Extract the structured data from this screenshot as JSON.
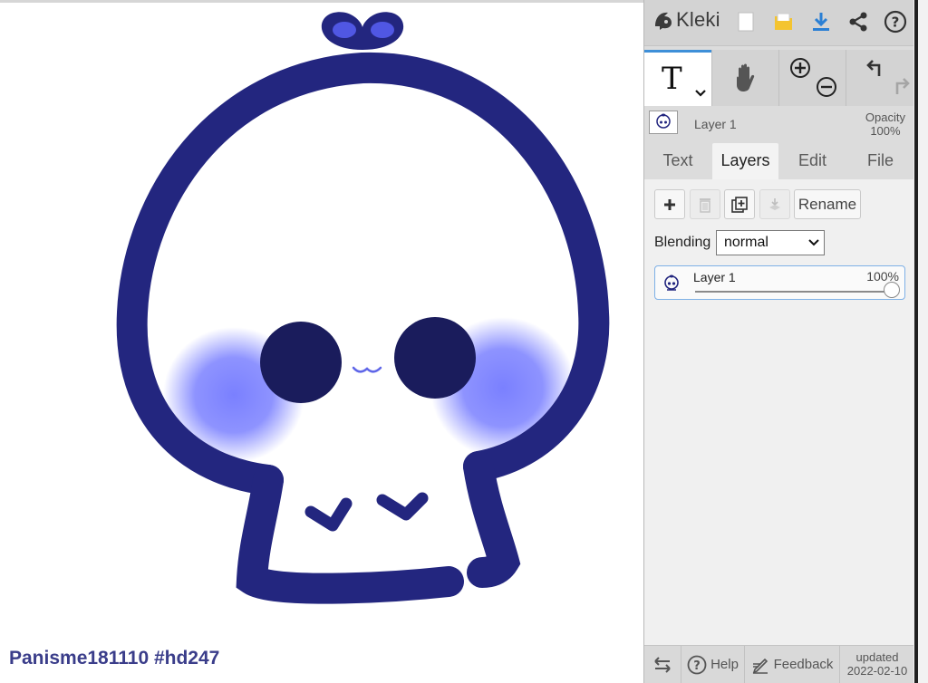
{
  "app": {
    "name": "Kleki",
    "updated_label": "updated",
    "updated_date": "2022-02-10"
  },
  "canvas": {
    "watermark": "Panisme181110 #hd247"
  },
  "header": {
    "icons": [
      "new-image-icon",
      "open-folder-icon",
      "download-icon",
      "share-icon",
      "help-circle-icon"
    ]
  },
  "toolbar": {
    "text_tool_glyph": "T"
  },
  "layer_info": {
    "name": "Layer 1",
    "opacity_label": "Opacity",
    "opacity_value": "100%"
  },
  "tabs": [
    {
      "label": "Text",
      "active": false
    },
    {
      "label": "Layers",
      "active": true
    },
    {
      "label": "Edit",
      "active": false
    },
    {
      "label": "File",
      "active": false
    }
  ],
  "layers_panel": {
    "rename_label": "Rename",
    "blending_label": "Blending",
    "blending_value": "normal",
    "layers": [
      {
        "name": "Layer 1",
        "opacity": "100%",
        "opacity_fraction": 1.0
      }
    ]
  },
  "footer": {
    "help_label": "Help",
    "feedback_label": "Feedback"
  },
  "colors": {
    "outline": "#23267f",
    "eyes": "#1a1c5c",
    "blush": "#7a80ff",
    "accent": "#3e8fd8",
    "download": "#2a7fd4",
    "folder": "#f2c230"
  }
}
